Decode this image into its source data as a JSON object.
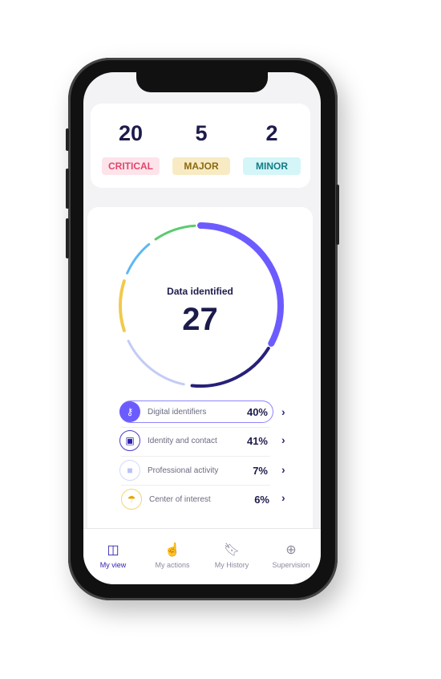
{
  "severity": [
    {
      "count": "20",
      "label": "CRITICAL",
      "bg": "#fde4ea",
      "fg": "#e2466b"
    },
    {
      "count": "5",
      "label": "MAJOR",
      "bg": "#f8ebc4",
      "fg": "#8a6a10"
    },
    {
      "count": "2",
      "label": "MINOR",
      "bg": "#d4f6f8",
      "fg": "#137c86"
    }
  ],
  "donut": {
    "title": "Data identified",
    "total": "27",
    "segments": [
      {
        "color": "#6c5cff"
      },
      {
        "color": "#27207a"
      },
      {
        "color": "#c3ccf6"
      },
      {
        "color": "#f2c94c"
      },
      {
        "color": "#5cb8f2"
      },
      {
        "color": "#5ccb6e"
      }
    ]
  },
  "categories": [
    {
      "label": "Digital identifiers",
      "percent": "40%",
      "icon": "key-icon",
      "color": "#6c5cff"
    },
    {
      "label": "Identity and contact",
      "percent": "41%",
      "icon": "id-card-icon",
      "color": "#4a3ccf"
    },
    {
      "label": "Professional activity",
      "percent": "7%",
      "icon": "briefcase-icon",
      "color": "#b9c2f5"
    },
    {
      "label": "Center of interest",
      "percent": "6%",
      "icon": "beach-umbrella-icon",
      "color": "#f2c94c"
    }
  ],
  "nav": [
    {
      "label": "My view",
      "icon": "layout-icon",
      "active": true
    },
    {
      "label": "My actions",
      "icon": "hand-icon"
    },
    {
      "label": "My History",
      "icon": "bookmark-icon"
    },
    {
      "label": "Supervision",
      "icon": "plus-circle-icon"
    }
  ],
  "colors": {
    "accent": "#2d1fb0",
    "text": "#1d1b4b"
  }
}
